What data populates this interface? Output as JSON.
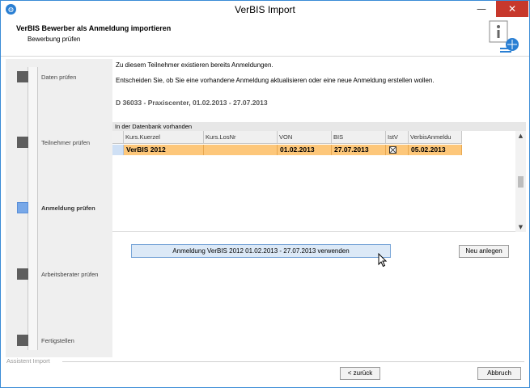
{
  "window": {
    "title": "VerBIS Import",
    "min_glyph": "—",
    "close_glyph": "✕"
  },
  "header": {
    "title": "VerBIS Bewerber als Anmeldung importieren",
    "subtitle": "Bewerbung prüfen"
  },
  "sidebar": {
    "steps": [
      {
        "label": "Daten prüfen",
        "active": false
      },
      {
        "label": "Teilnehmer prüfen",
        "active": false
      },
      {
        "label": "Anmeldung prüfen",
        "active": true
      },
      {
        "label": "Arbeitsberater prüfen",
        "active": false
      },
      {
        "label": "Fertigstellen",
        "active": false
      }
    ]
  },
  "main": {
    "message1": "Zu diesem Teilnehmer existieren bereits Anmeldungen.",
    "message2": "Entscheiden Sie, ob Sie eine vorhandene Anmeldung aktualisieren oder eine neue Anmeldung erstellen wollen.",
    "course": "D 36033 - Praxiscenter, 01.02.2013 - 27.07.2013",
    "grid_caption": "In der Datenbank vorhanden",
    "columns": [
      "Kurs.Kuerzel",
      "Kurs.LosNr",
      "VON",
      "BIS",
      "IstV",
      "VerbisAnmeldu"
    ],
    "rows": [
      {
        "kuerzel": "VerBIS 2012",
        "losnr": "",
        "von": "01.02.2013",
        "bis": "27.07.2013",
        "istv": true,
        "verbis_anmeldung": "05.02.2013"
      }
    ],
    "use_button": "Anmeldung VerBIS 2012 01.02.2013 - 27.07.2013 verwenden",
    "new_button": "Neu anlegen",
    "scroll_up": "▲",
    "scroll_down": "▼"
  },
  "footer": {
    "group_label": "Assistent Import",
    "back_button": "< zurück",
    "cancel_button": "Abbruch"
  },
  "icons": {
    "app": "app-globe-icon",
    "header_logo": "document-info-icon"
  },
  "colors": {
    "selected_row": "#fdc77a",
    "active_step": "#78a8e8",
    "primary_button": "#dce9f7"
  }
}
